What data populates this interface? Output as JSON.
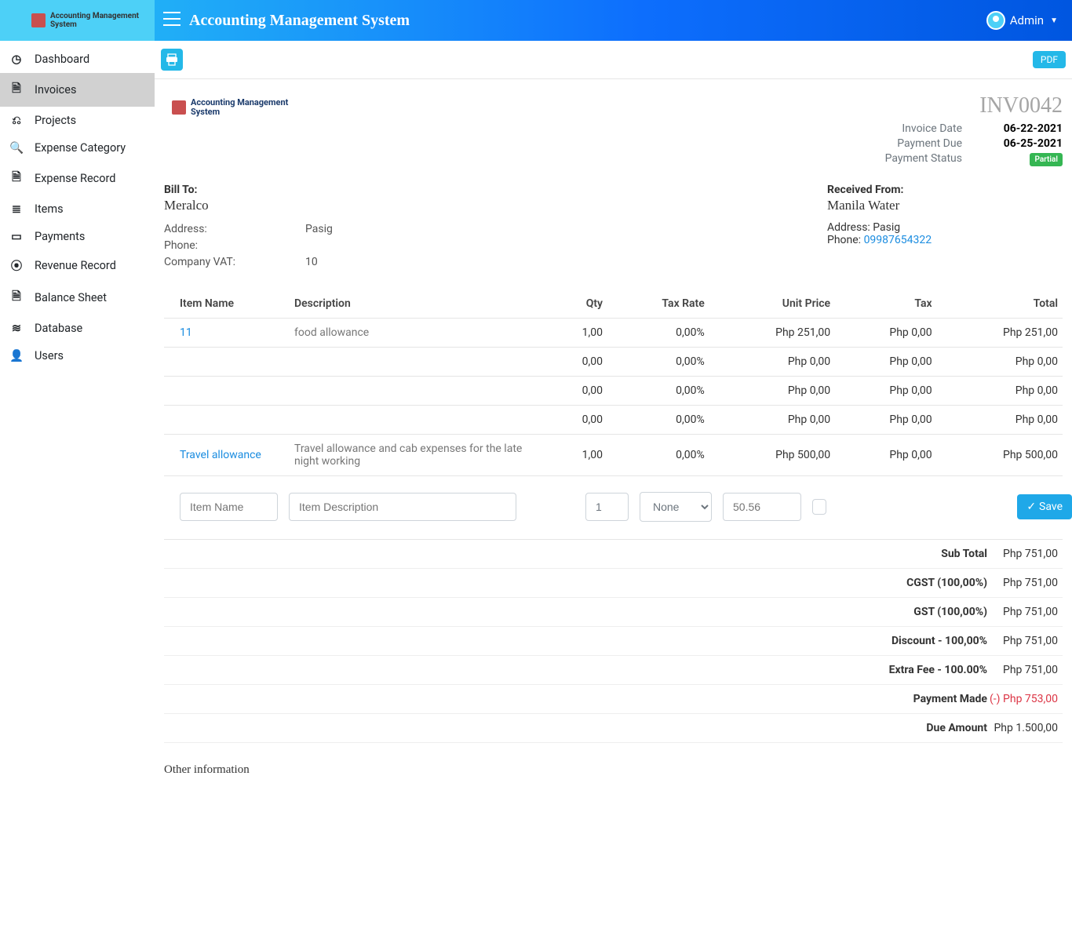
{
  "header": {
    "brand_top": "Accounting Management",
    "brand_bottom": "System",
    "title": "Accounting Management System",
    "user": "Admin"
  },
  "sidebar": {
    "items": [
      {
        "label": "Dashboard"
      },
      {
        "label": "Invoices"
      },
      {
        "label": "Projects"
      },
      {
        "label": "Expense Category"
      },
      {
        "label": "Expense Record"
      },
      {
        "label": "Items"
      },
      {
        "label": "Payments"
      },
      {
        "label": "Revenue Record"
      },
      {
        "label": "Balance Sheet"
      },
      {
        "label": "Database"
      },
      {
        "label": "Users"
      }
    ]
  },
  "toolbar": {
    "pdf_label": "PDF"
  },
  "invoice": {
    "number": "INV0042",
    "date_label": "Invoice Date",
    "date": "06-22-2021",
    "due_label": "Payment Due",
    "due": "06-25-2021",
    "status_label": "Payment Status",
    "status_badge": "Partial",
    "bill_to_title": "Bill To:",
    "bill_to_name": "Meralco",
    "bill_to": {
      "address_label": "Address:",
      "address": "Pasig",
      "phone_label": "Phone:",
      "phone": "",
      "vat_label": "Company VAT:",
      "vat": "10"
    },
    "recv_title": "Received From:",
    "recv_name": "Manila Water",
    "recv": {
      "address_label": "Address:",
      "address": "Pasig",
      "phone_label": "Phone:",
      "phone": "09987654322"
    },
    "cols": {
      "item": "Item Name",
      "desc": "Description",
      "qty": "Qty",
      "rate": "Tax Rate",
      "unit": "Unit Price",
      "tax": "Tax",
      "total": "Total"
    },
    "rows": [
      {
        "item": "11",
        "desc": "food allowance",
        "qty": "1,00",
        "rate": "0,00%",
        "unit": "Php 251,00",
        "tax": "Php 0,00",
        "total": "Php 251,00",
        "link": true
      },
      {
        "item": "",
        "desc": "",
        "qty": "0,00",
        "rate": "0,00%",
        "unit": "Php 0,00",
        "tax": "Php 0,00",
        "total": "Php 0,00"
      },
      {
        "item": "",
        "desc": "",
        "qty": "0,00",
        "rate": "0,00%",
        "unit": "Php 0,00",
        "tax": "Php 0,00",
        "total": "Php 0,00"
      },
      {
        "item": "",
        "desc": "",
        "qty": "0,00",
        "rate": "0,00%",
        "unit": "Php 0,00",
        "tax": "Php 0,00",
        "total": "Php 0,00"
      },
      {
        "item": "Travel allowance",
        "desc": "Travel allowance and cab expenses for the late night working",
        "qty": "1,00",
        "rate": "0,00%",
        "unit": "Php 500,00",
        "tax": "Php 0,00",
        "total": "Php 500,00",
        "link": true
      }
    ],
    "entry": {
      "item_ph": "Item Name",
      "desc_ph": "Item Description",
      "qty": "1",
      "tax_sel": "None",
      "price_ph": "50.56",
      "save": "Save"
    },
    "totals": [
      {
        "label": "Sub Total",
        "value": "Php 751,00"
      },
      {
        "label": "CGST (100,00%)",
        "value": "Php 751,00"
      },
      {
        "label": "GST (100,00%)",
        "value": "Php 751,00"
      },
      {
        "label": "Discount - 100,00%",
        "value": "Php 751,00"
      },
      {
        "label": "Extra Fee - 100.00%",
        "value": "Php 751,00"
      },
      {
        "label": "Payment Made",
        "value": "(-) Php 753,00",
        "neg": true
      },
      {
        "label": "Due Amount",
        "value": "Php 1.500,00"
      }
    ],
    "other_label": "Other information"
  }
}
